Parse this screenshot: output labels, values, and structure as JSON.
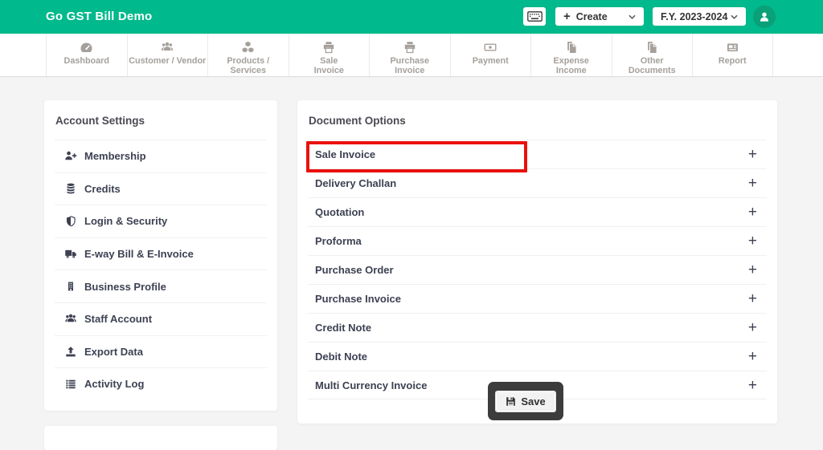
{
  "header": {
    "title": "Go GST Bill Demo",
    "create_plus": "+",
    "create_label": "Create",
    "fy_value": "F.Y. 2023-2024"
  },
  "nav": {
    "items": [
      {
        "line1": "Dashboard",
        "icon": "tachometer-icon"
      },
      {
        "line1": "Customer / Vendor",
        "icon": "users-icon"
      },
      {
        "line1": "Products / Services",
        "icon": "cubes-icon"
      },
      {
        "line1": "Sale",
        "line2": "Invoice",
        "icon": "printer-icon"
      },
      {
        "line1": "Purchase",
        "line2": "Invoice",
        "icon": "printer-icon"
      },
      {
        "line1": "Payment",
        "icon": "money-icon"
      },
      {
        "line1": "Expense",
        "line2": "Income",
        "icon": "files-icon"
      },
      {
        "line1": "Other",
        "line2": "Documents",
        "icon": "files-icon"
      },
      {
        "line1": "Report",
        "icon": "newspaper-icon"
      }
    ]
  },
  "sidebar": {
    "title": "Account Settings",
    "items": [
      {
        "label": "Membership",
        "icon": "user-plus-icon"
      },
      {
        "label": "Credits",
        "icon": "database-icon"
      },
      {
        "label": "Login & Security",
        "icon": "shield-icon"
      },
      {
        "label": "E-way Bill & E-Invoice",
        "icon": "truck-icon"
      },
      {
        "label": "Business Profile",
        "icon": "building-icon"
      },
      {
        "label": "Staff Account",
        "icon": "users-icon"
      },
      {
        "label": "Export Data",
        "icon": "upload-icon"
      },
      {
        "label": "Activity Log",
        "icon": "list-icon"
      }
    ]
  },
  "main": {
    "title": "Document Options",
    "expand_symbol": "+",
    "items": [
      "Sale Invoice",
      "Delivery Challan",
      "Quotation",
      "Proforma",
      "Purchase Order",
      "Purchase Invoice",
      "Credit Note",
      "Debit Note",
      "Multi Currency Invoice"
    ],
    "highlighted_item": "Sale Invoice"
  },
  "save": {
    "label": "Save",
    "icon": "floppy-icon"
  },
  "colors": {
    "brand_green": "#00b98c",
    "avatar_green": "#0aa078",
    "highlight_red": "#e9110d",
    "save_box_dark": "#3c3c3c",
    "nav_gray": "#a5a09b",
    "text_dark": "#3d4152"
  }
}
